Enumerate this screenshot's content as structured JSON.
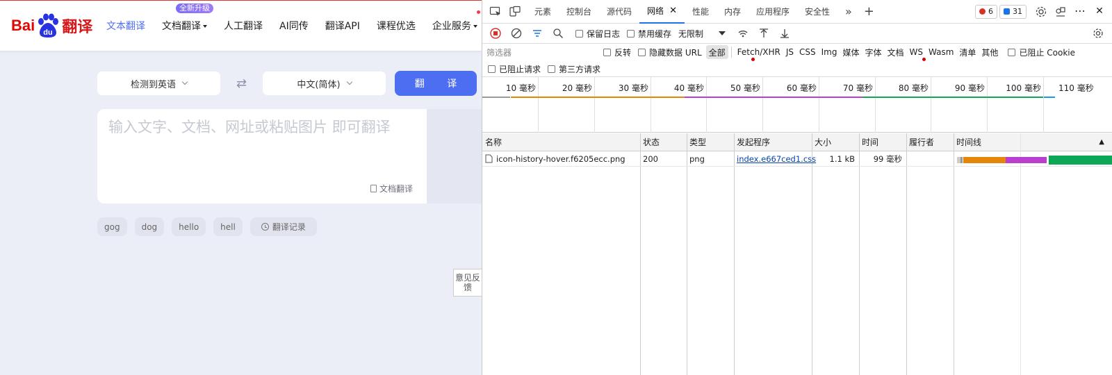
{
  "brand": {
    "logo_text_left": "Bai",
    "logo_text_paw": "du",
    "logo_text_right": "翻译"
  },
  "nav": {
    "items": [
      {
        "label": "文本翻译",
        "active": true
      },
      {
        "label": "文档翻译",
        "badge": "全新升级",
        "dropdown": true
      },
      {
        "label": "人工翻译"
      },
      {
        "label": "AI同传"
      },
      {
        "label": "翻译API"
      },
      {
        "label": "课程优选"
      },
      {
        "label": "企业服务",
        "dropdown": true,
        "dot": true
      }
    ]
  },
  "translator": {
    "source_lang": "检测到英语",
    "target_lang": "中文(简体)",
    "translate_button": "翻 译",
    "input_placeholder": "输入文字、文档、网址或粘贴图片 即可翻译",
    "doc_translate_link": "文档翻译"
  },
  "history": {
    "chips": [
      "gog",
      "dog",
      "hello",
      "hell"
    ],
    "record_label": "翻译记录"
  },
  "feedback": {
    "label": "意见反馈"
  },
  "devtools": {
    "tabs": [
      {
        "label": "元素"
      },
      {
        "label": "控制台"
      },
      {
        "label": "源代码"
      },
      {
        "label": "网络",
        "active": true
      },
      {
        "label": "性能"
      },
      {
        "label": "内存"
      },
      {
        "label": "应用程序"
      },
      {
        "label": "安全性"
      }
    ],
    "error_count": "6",
    "message_count": "31",
    "toolbar": {
      "preserve_log": "保留日志",
      "disable_cache": "禁用缓存",
      "throttling": "无限制"
    },
    "filter": {
      "placeholder": "筛选器",
      "invert": "反转",
      "hide_data_urls": "隐藏数据 URL",
      "types": [
        "全部",
        "Fetch/XHR",
        "JS",
        "CSS",
        "Img",
        "媒体",
        "字体",
        "文档",
        "WS",
        "Wasm",
        "清单",
        "其他"
      ],
      "blocked_cookies": "已阻止 Cookie",
      "blocked_requests": "已阻止请求",
      "third_party": "第三方请求"
    },
    "overview_ticks": [
      "10 毫秒",
      "20 毫秒",
      "30 毫秒",
      "40 毫秒",
      "50 毫秒",
      "60 毫秒",
      "70 毫秒",
      "80 毫秒",
      "90 毫秒",
      "100 毫秒",
      "110 毫秒"
    ],
    "columns": [
      "名称",
      "状态",
      "类型",
      "发起程序",
      "大小",
      "时间",
      "履行者",
      "时间线"
    ],
    "rows": [
      {
        "name": "icon-history-hover.f6205ecc.png",
        "status": "200",
        "type": "png",
        "initiator": "index.e667ced1.css",
        "size": "1.1 kB",
        "time": "99 毫秒",
        "fulfilled_by": ""
      }
    ],
    "colors": {
      "orange": "#e5860b",
      "purple": "#b83fcf",
      "green": "#0ca858",
      "blue": "#1a73e8"
    }
  }
}
